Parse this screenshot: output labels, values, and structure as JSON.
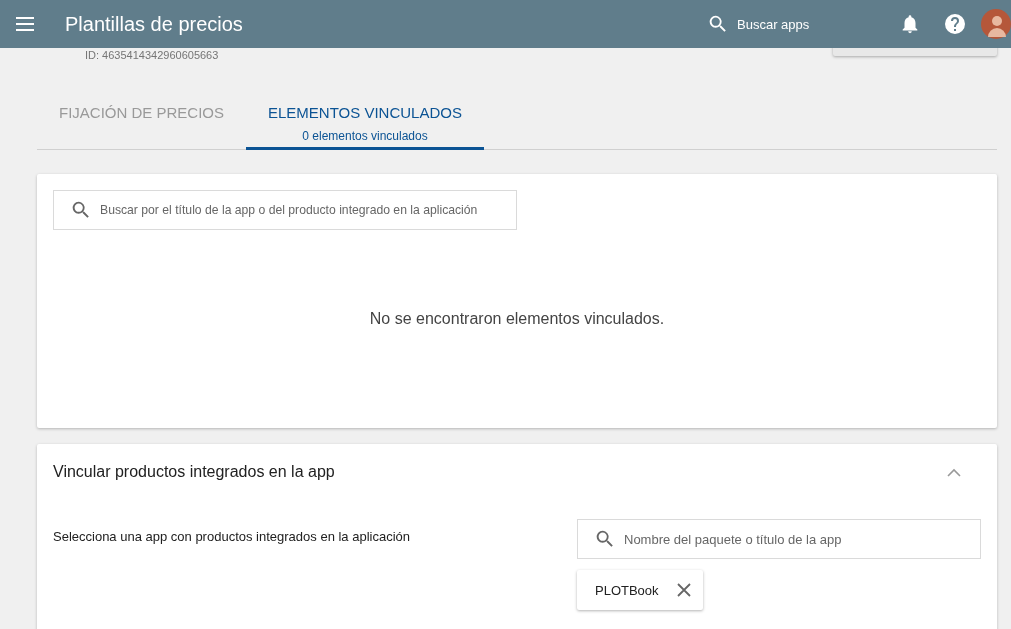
{
  "header": {
    "title": "Plantillas de precios",
    "search": {
      "placeholder": "Buscar apps"
    }
  },
  "template": {
    "id": "ID: 4635414342960605663"
  },
  "tabs": [
    {
      "label": "FIJACIÓN DE PRECIOS",
      "selected": false
    },
    {
      "label": "ELEMENTOS VINCULADOS",
      "subtitle": "0 elementos vinculados",
      "selected": true
    }
  ],
  "linked_items": {
    "search": {
      "placeholder": "Buscar por el título de la app o del producto integrado en la aplicación"
    },
    "empty_message": "No se encontraron elementos vinculados."
  },
  "link_products": {
    "title": "Vincular productos integrados en la app",
    "expanded": true,
    "label": "Selecciona una app con productos integrados en la aplicación",
    "search": {
      "placeholder": "Nombre del paquete o título de la app"
    },
    "chips": [
      {
        "label": "PLOTBook"
      }
    ]
  }
}
